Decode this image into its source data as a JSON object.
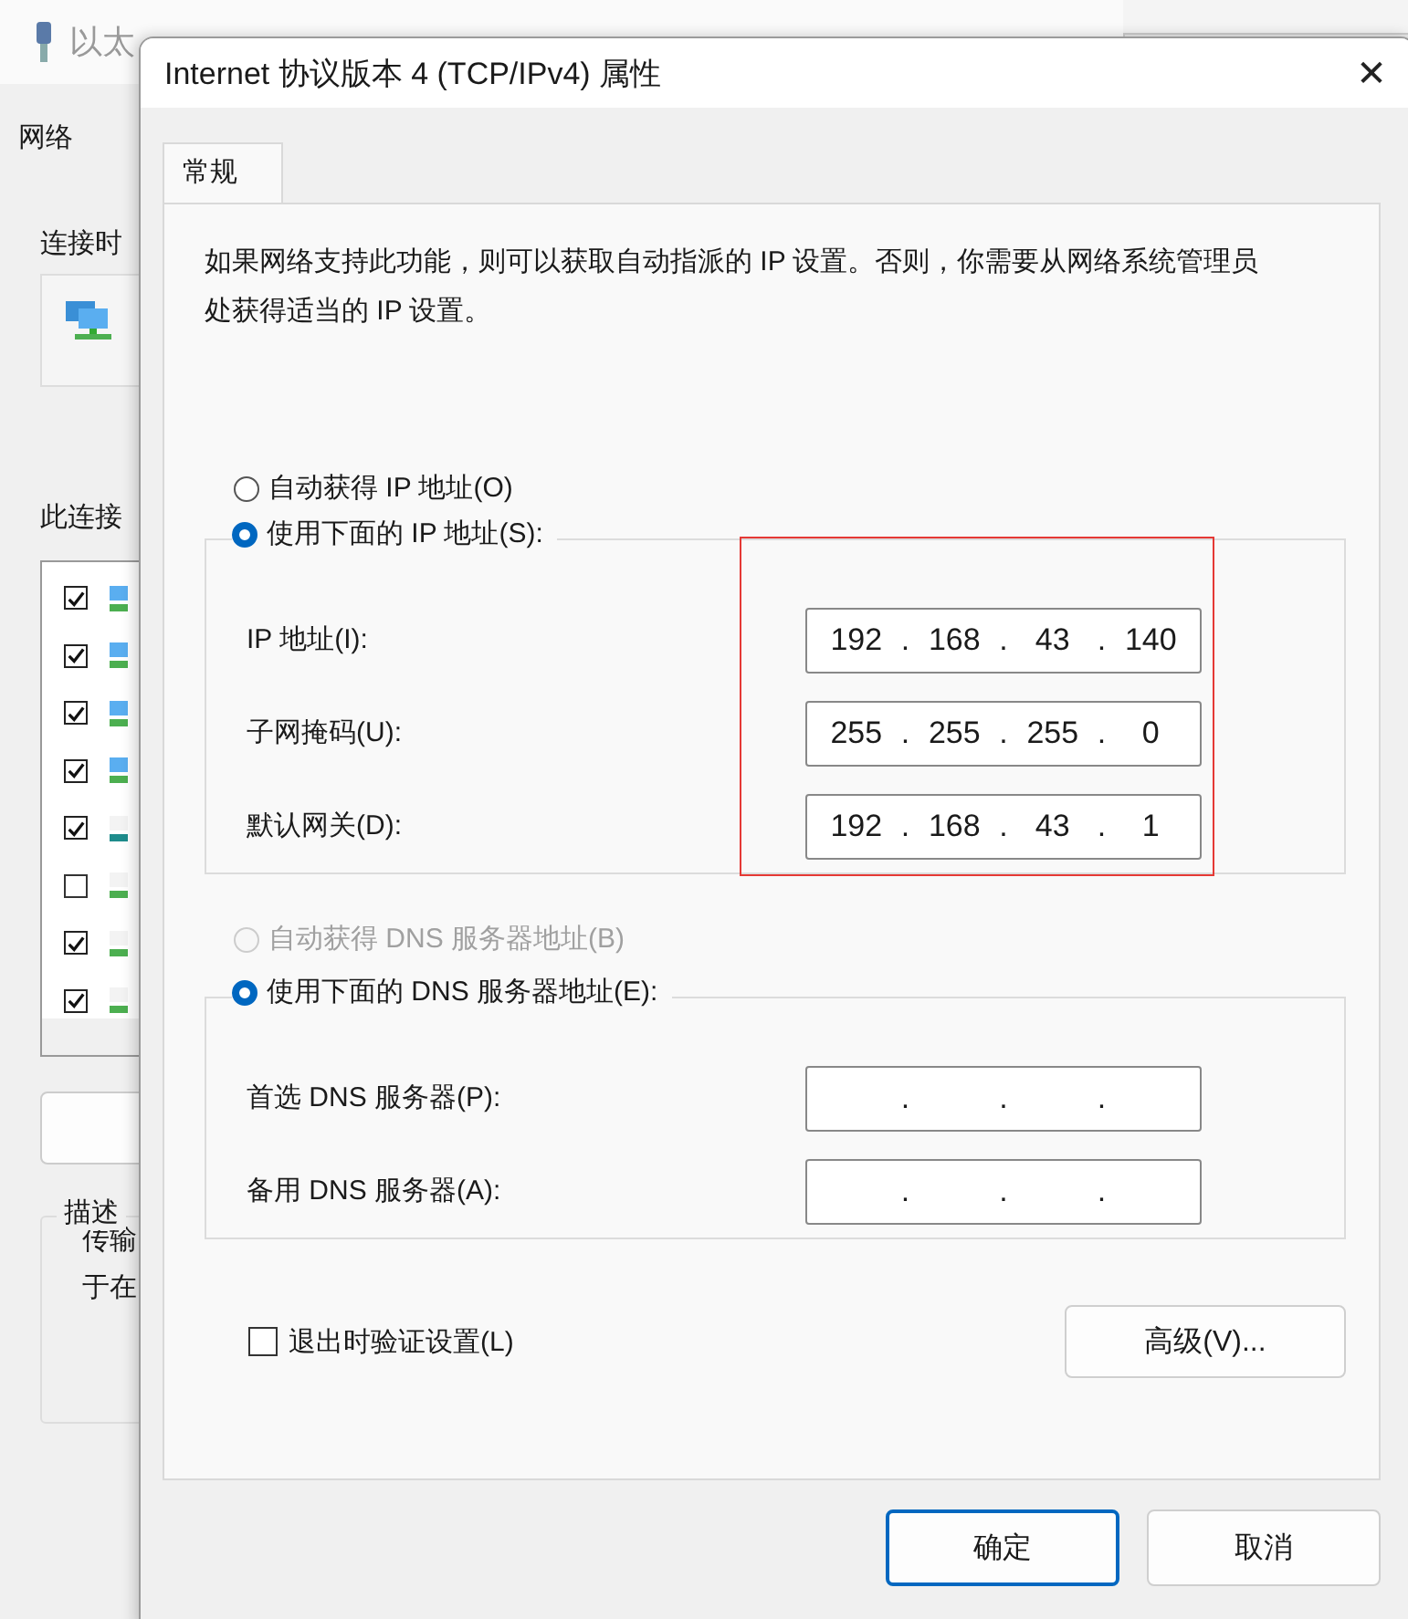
{
  "background_window": {
    "title": "以太",
    "tab": "网络",
    "connect_label": "连接时",
    "items_label": "此连接",
    "items": [
      {
        "checked": true
      },
      {
        "checked": true
      },
      {
        "checked": true
      },
      {
        "checked": true
      },
      {
        "checked": true
      },
      {
        "checked": false
      },
      {
        "checked": true
      },
      {
        "checked": true
      }
    ],
    "description": {
      "title": "描述",
      "lines": [
        "传输",
        "于在"
      ]
    }
  },
  "dialog": {
    "title": "Internet 协议版本 4 (TCP/IPv4) 属性",
    "close": "✕",
    "tabs": [
      {
        "label": "常规",
        "selected": true
      }
    ],
    "intro": "如果网络支持此功能，则可以获取自动指派的 IP 设置。否则，你需要从网络系统管理员处获得适当的 IP 设置。",
    "ip_options": [
      {
        "label": "自动获得 IP 地址(O)",
        "selected": false,
        "disabled": false
      },
      {
        "label": "使用下面的 IP 地址(S):",
        "selected": true,
        "disabled": false
      }
    ],
    "ip_fields": [
      {
        "label": "IP 地址(I):",
        "octets": [
          "192",
          "168",
          "43",
          "140"
        ],
        "separators": [
          ".",
          ".",
          "."
        ]
      },
      {
        "label": "子网掩码(U):",
        "octets": [
          "255",
          "255",
          "255",
          "0"
        ],
        "separators": [
          ".",
          ".",
          "."
        ]
      },
      {
        "label": "默认网关(D):",
        "octets": [
          "192",
          "168",
          "43",
          "1"
        ],
        "separators": [
          ".",
          ".",
          "."
        ]
      }
    ],
    "dns_options": [
      {
        "label": "自动获得 DNS 服务器地址(B)",
        "selected": false,
        "disabled": true
      },
      {
        "label": "使用下面的 DNS 服务器地址(E):",
        "selected": true,
        "disabled": false
      }
    ],
    "dns_fields": [
      {
        "label": "首选 DNS 服务器(P):",
        "separators": [
          ".",
          ".",
          "."
        ]
      },
      {
        "label": "备用 DNS 服务器(A):",
        "separators": [
          ".",
          ".",
          "."
        ]
      }
    ],
    "validate_on_exit": {
      "label": "退出时验证设置(L)",
      "checked": false
    },
    "advanced_button": "高级(V)...",
    "buttons": [
      {
        "label": "确定",
        "kind": "default"
      },
      {
        "label": "取消",
        "kind": "normal"
      }
    ]
  }
}
